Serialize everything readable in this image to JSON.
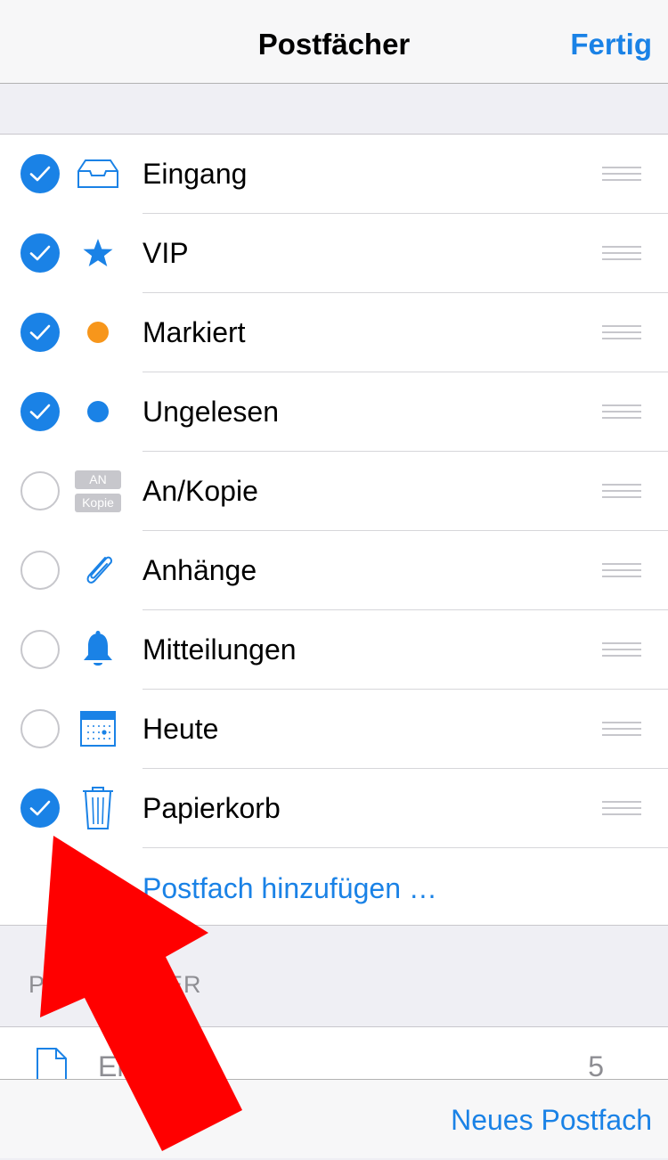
{
  "navbar": {
    "title": "Postfächer",
    "done_label": "Fertig"
  },
  "mailboxes": [
    {
      "label": "Eingang",
      "checked": true,
      "icon": "inbox-tray-icon"
    },
    {
      "label": "VIP",
      "checked": true,
      "icon": "star-icon"
    },
    {
      "label": "Markiert",
      "checked": true,
      "icon": "orange-dot-icon"
    },
    {
      "label": "Ungelesen",
      "checked": true,
      "icon": "blue-dot-icon"
    },
    {
      "label": "An/Kopie",
      "checked": false,
      "icon": "to-cc-badge-icon",
      "badge_top": "AN",
      "badge_bottom": "Kopie"
    },
    {
      "label": "Anhänge",
      "checked": false,
      "icon": "paperclip-icon"
    },
    {
      "label": "Mitteilungen",
      "checked": false,
      "icon": "bell-icon"
    },
    {
      "label": "Heute",
      "checked": false,
      "icon": "calendar-icon"
    },
    {
      "label": "Papierkorb",
      "checked": true,
      "icon": "trash-icon"
    }
  ],
  "add_mailbox_label": "Postfach hinzufügen …",
  "section_header": "POSTFÄCHER",
  "folder_row": {
    "label": "Entwürfe",
    "count": "5",
    "icon": "document-icon"
  },
  "toolbar": {
    "new_mailbox_label": "Neues Postfach"
  },
  "colors": {
    "accent": "#1a82e6",
    "flag": "#f7961b",
    "annotation_arrow": "#ff0000"
  }
}
